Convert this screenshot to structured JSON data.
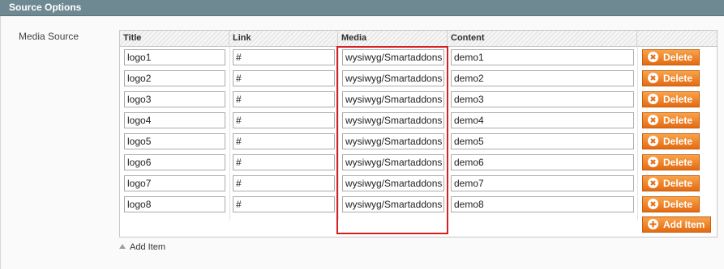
{
  "section": {
    "title": "Source Options"
  },
  "field_label": "Media Source",
  "columns": [
    "Title",
    "Link",
    "Media",
    "Content"
  ],
  "rows": [
    {
      "title": "logo1",
      "link": "#",
      "media": "wysiwyg/Smartaddons",
      "content": "demo1"
    },
    {
      "title": "logo2",
      "link": "#",
      "media": "wysiwyg/Smartaddons",
      "content": "demo2"
    },
    {
      "title": "logo3",
      "link": "#",
      "media": "wysiwyg/Smartaddons",
      "content": "demo3"
    },
    {
      "title": "logo4",
      "link": "#",
      "media": "wysiwyg/Smartaddons",
      "content": "demo4"
    },
    {
      "title": "logo5",
      "link": "#",
      "media": "wysiwyg/Smartaddons",
      "content": "demo5"
    },
    {
      "title": "logo6",
      "link": "#",
      "media": "wysiwyg/Smartaddons",
      "content": "demo6"
    },
    {
      "title": "logo7",
      "link": "#",
      "media": "wysiwyg/Smartaddons",
      "content": "demo7"
    },
    {
      "title": "logo8",
      "link": "#",
      "media": "wysiwyg/Smartaddons",
      "content": "demo8"
    }
  ],
  "buttons": {
    "delete": "Delete",
    "add_item": "Add Item"
  },
  "bottom_link": "Add Item",
  "icons": {
    "delete": "delete-circle-icon",
    "add": "add-circle-icon",
    "toggle": "triangle-up-icon"
  },
  "colors": {
    "header": "#6f8992",
    "button": "#ee7a1f",
    "highlight": "#d42020"
  }
}
